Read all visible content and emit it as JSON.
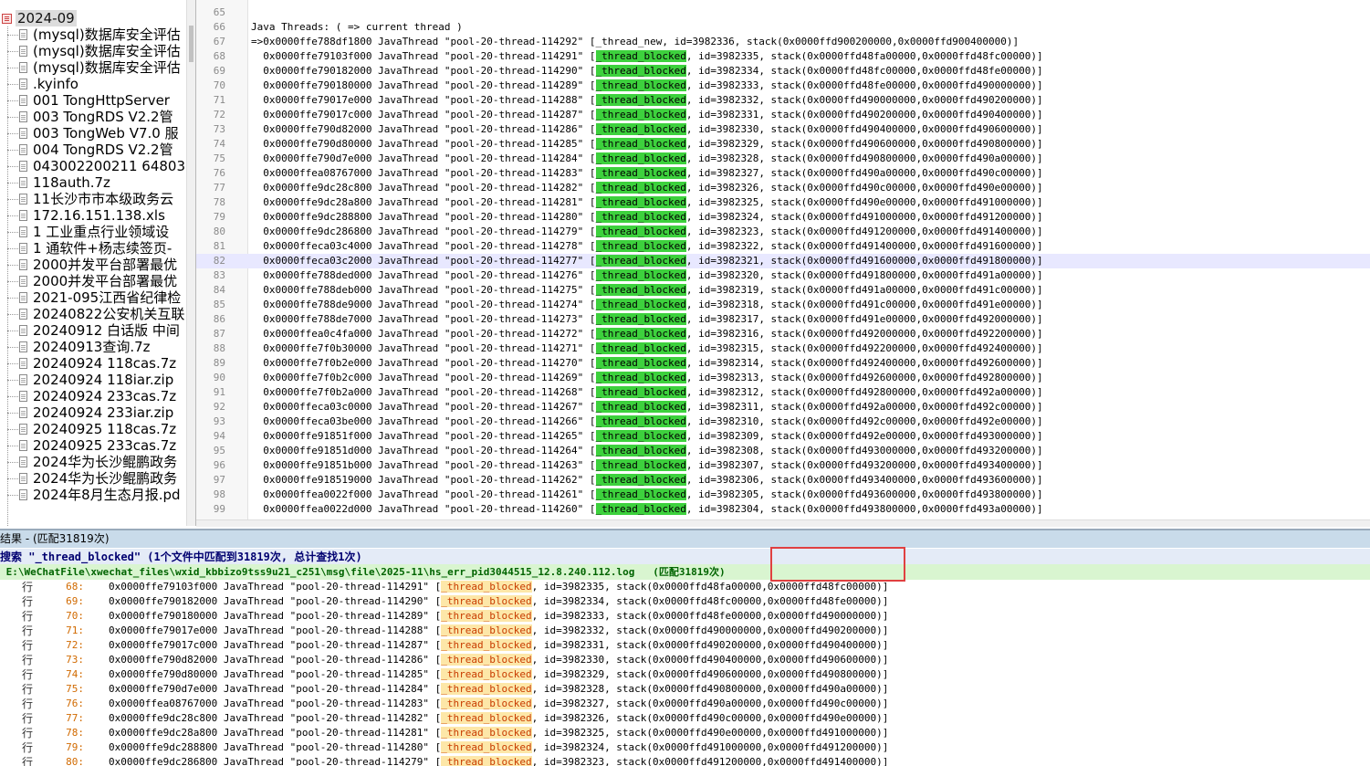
{
  "tree": {
    "root": "2024-09",
    "items": [
      "(mysql)数据库安全评估",
      "(mysql)数据库安全评估",
      "(mysql)数据库安全评估",
      ".kyinfo",
      "001 TongHttpServer",
      "003 TongRDS V2.2管",
      "003 TongWeb V7.0 服",
      "004 TongRDS V2.2管",
      "043002200211 64803",
      "118auth.7z",
      "11长沙市市本级政务云",
      "172.16.151.138.xls",
      "1 工业重点行业领域设",
      "1 通软件+杨志续签页-",
      "2000并发平台部署最优",
      "2000并发平台部署最优",
      "2021-095江西省纪律检",
      "20240822公安机关互联",
      "20240912 白话版 中间",
      "20240913查询.7z",
      "20240924 118cas.7z",
      "20240924 118iar.zip",
      "20240924 233cas.7z",
      "20240924 233iar.zip",
      "20240925 118cas.7z",
      "20240925 233cas.7z",
      "2024华为长沙鲲鹏政务",
      "2024华为长沙鲲鹏政务",
      "2024年8月生态月报.pd"
    ]
  },
  "editor": {
    "lines": [
      {
        "n": "65",
        "pre": "",
        "hl": "",
        "post": ""
      },
      {
        "n": "66",
        "pre": "Java Threads: ( => current thread )",
        "hl": "",
        "post": ""
      },
      {
        "n": "67",
        "pre": "=>0x0000ffe788df1800 JavaThread \"pool-20-thread-114292\" [_thread_new, id=3982336, stack(0x0000ffd900200000,0x0000ffd900400000)]",
        "hl": "",
        "post": ""
      },
      {
        "n": "68",
        "pre": "  0x0000ffe79103f000 JavaThread \"pool-20-thread-114291\" [",
        "hl": "_thread_blocked",
        "post": ", id=3982335, stack(0x0000ffd48fa00000,0x0000ffd48fc00000)]"
      },
      {
        "n": "69",
        "pre": "  0x0000ffe790182000 JavaThread \"pool-20-thread-114290\" [",
        "hl": "_thread_blocked",
        "post": ", id=3982334, stack(0x0000ffd48fc00000,0x0000ffd48fe00000)]"
      },
      {
        "n": "70",
        "pre": "  0x0000ffe790180000 JavaThread \"pool-20-thread-114289\" [",
        "hl": "_thread_blocked",
        "post": ", id=3982333, stack(0x0000ffd48fe00000,0x0000ffd490000000)]"
      },
      {
        "n": "71",
        "pre": "  0x0000ffe79017e000 JavaThread \"pool-20-thread-114288\" [",
        "hl": "_thread_blocked",
        "post": ", id=3982332, stack(0x0000ffd490000000,0x0000ffd490200000)]"
      },
      {
        "n": "72",
        "pre": "  0x0000ffe79017c000 JavaThread \"pool-20-thread-114287\" [",
        "hl": "_thread_blocked",
        "post": ", id=3982331, stack(0x0000ffd490200000,0x0000ffd490400000)]"
      },
      {
        "n": "73",
        "pre": "  0x0000ffe790d82000 JavaThread \"pool-20-thread-114286\" [",
        "hl": "_thread_blocked",
        "post": ", id=3982330, stack(0x0000ffd490400000,0x0000ffd490600000)]"
      },
      {
        "n": "74",
        "pre": "  0x0000ffe790d80000 JavaThread \"pool-20-thread-114285\" [",
        "hl": "_thread_blocked",
        "post": ", id=3982329, stack(0x0000ffd490600000,0x0000ffd490800000)]"
      },
      {
        "n": "75",
        "pre": "  0x0000ffe790d7e000 JavaThread \"pool-20-thread-114284\" [",
        "hl": "_thread_blocked",
        "post": ", id=3982328, stack(0x0000ffd490800000,0x0000ffd490a00000)]"
      },
      {
        "n": "76",
        "pre": "  0x0000ffea08767000 JavaThread \"pool-20-thread-114283\" [",
        "hl": "_thread_blocked",
        "post": ", id=3982327, stack(0x0000ffd490a00000,0x0000ffd490c00000)]"
      },
      {
        "n": "77",
        "pre": "  0x0000ffe9dc28c800 JavaThread \"pool-20-thread-114282\" [",
        "hl": "_thread_blocked",
        "post": ", id=3982326, stack(0x0000ffd490c00000,0x0000ffd490e00000)]"
      },
      {
        "n": "78",
        "pre": "  0x0000ffe9dc28a800 JavaThread \"pool-20-thread-114281\" [",
        "hl": "_thread_blocked",
        "post": ", id=3982325, stack(0x0000ffd490e00000,0x0000ffd491000000)]"
      },
      {
        "n": "79",
        "pre": "  0x0000ffe9dc288800 JavaThread \"pool-20-thread-114280\" [",
        "hl": "_thread_blocked",
        "post": ", id=3982324, stack(0x0000ffd491000000,0x0000ffd491200000)]"
      },
      {
        "n": "80",
        "pre": "  0x0000ffe9dc286800 JavaThread \"pool-20-thread-114279\" [",
        "hl": "_thread_blocked",
        "post": ", id=3982323, stack(0x0000ffd491200000,0x0000ffd491400000)]"
      },
      {
        "n": "81",
        "pre": "  0x0000ffeca03c4000 JavaThread \"pool-20-thread-114278\" [",
        "hl": "_thread_blocked",
        "post": ", id=3982322, stack(0x0000ffd491400000,0x0000ffd491600000)]"
      },
      {
        "n": "82",
        "pre": "  0x0000ffeca03c2000 JavaThread \"pool-20-thread-114277\" [",
        "hl": "_thread_blocked",
        "post": ", id=3982321, stack(0x0000ffd491600000,0x0000ffd491800000)]"
      },
      {
        "n": "83",
        "pre": "  0x0000ffe788ded000 JavaThread \"pool-20-thread-114276\" [",
        "hl": "_thread_blocked",
        "post": ", id=3982320, stack(0x0000ffd491800000,0x0000ffd491a00000)]"
      },
      {
        "n": "84",
        "pre": "  0x0000ffe788deb000 JavaThread \"pool-20-thread-114275\" [",
        "hl": "_thread_blocked",
        "post": ", id=3982319, stack(0x0000ffd491a00000,0x0000ffd491c00000)]"
      },
      {
        "n": "85",
        "pre": "  0x0000ffe788de9000 JavaThread \"pool-20-thread-114274\" [",
        "hl": "_thread_blocked",
        "post": ", id=3982318, stack(0x0000ffd491c00000,0x0000ffd491e00000)]"
      },
      {
        "n": "86",
        "pre": "  0x0000ffe788de7000 JavaThread \"pool-20-thread-114273\" [",
        "hl": "_thread_blocked",
        "post": ", id=3982317, stack(0x0000ffd491e00000,0x0000ffd492000000)]"
      },
      {
        "n": "87",
        "pre": "  0x0000ffea0c4fa000 JavaThread \"pool-20-thread-114272\" [",
        "hl": "_thread_blocked",
        "post": ", id=3982316, stack(0x0000ffd492000000,0x0000ffd492200000)]"
      },
      {
        "n": "88",
        "pre": "  0x0000ffe7f0b30000 JavaThread \"pool-20-thread-114271\" [",
        "hl": "_thread_blocked",
        "post": ", id=3982315, stack(0x0000ffd492200000,0x0000ffd492400000)]"
      },
      {
        "n": "89",
        "pre": "  0x0000ffe7f0b2e000 JavaThread \"pool-20-thread-114270\" [",
        "hl": "_thread_blocked",
        "post": ", id=3982314, stack(0x0000ffd492400000,0x0000ffd492600000)]"
      },
      {
        "n": "90",
        "pre": "  0x0000ffe7f0b2c000 JavaThread \"pool-20-thread-114269\" [",
        "hl": "_thread_blocked",
        "post": ", id=3982313, stack(0x0000ffd492600000,0x0000ffd492800000)]"
      },
      {
        "n": "91",
        "pre": "  0x0000ffe7f0b2a000 JavaThread \"pool-20-thread-114268\" [",
        "hl": "_thread_blocked",
        "post": ", id=3982312, stack(0x0000ffd492800000,0x0000ffd492a00000)]"
      },
      {
        "n": "92",
        "pre": "  0x0000ffeca03c0000 JavaThread \"pool-20-thread-114267\" [",
        "hl": "_thread_blocked",
        "post": ", id=3982311, stack(0x0000ffd492a00000,0x0000ffd492c00000)]"
      },
      {
        "n": "93",
        "pre": "  0x0000ffeca03be000 JavaThread \"pool-20-thread-114266\" [",
        "hl": "_thread_blocked",
        "post": ", id=3982310, stack(0x0000ffd492c00000,0x0000ffd492e00000)]"
      },
      {
        "n": "94",
        "pre": "  0x0000ffe91851f000 JavaThread \"pool-20-thread-114265\" [",
        "hl": "_thread_blocked",
        "post": ", id=3982309, stack(0x0000ffd492e00000,0x0000ffd493000000)]"
      },
      {
        "n": "95",
        "pre": "  0x0000ffe91851d000 JavaThread \"pool-20-thread-114264\" [",
        "hl": "_thread_blocked",
        "post": ", id=3982308, stack(0x0000ffd493000000,0x0000ffd493200000)]"
      },
      {
        "n": "96",
        "pre": "  0x0000ffe91851b000 JavaThread \"pool-20-thread-114263\" [",
        "hl": "_thread_blocked",
        "post": ", id=3982307, stack(0x0000ffd493200000,0x0000ffd493400000)]"
      },
      {
        "n": "97",
        "pre": "  0x0000ffe918519000 JavaThread \"pool-20-thread-114262\" [",
        "hl": "_thread_blocked",
        "post": ", id=3982306, stack(0x0000ffd493400000,0x0000ffd493600000)]"
      },
      {
        "n": "98",
        "pre": "  0x0000ffea0022f000 JavaThread \"pool-20-thread-114261\" [",
        "hl": "_thread_blocked",
        "post": ", id=3982305, stack(0x0000ffd493600000,0x0000ffd493800000)]"
      },
      {
        "n": "99",
        "pre": "  0x0000ffea0022d000 JavaThread \"pool-20-thread-114260\" [",
        "hl": "_thread_blocked",
        "post": ", id=3982304, stack(0x0000ffd493800000,0x0000ffd493a00000)]"
      }
    ],
    "current_line": "82"
  },
  "results": {
    "title": "结果 - (匹配31819次)",
    "search_summary": "搜索 \"_thread_blocked\" (1个文件中匹配到31819次, 总计查找1次)",
    "file_path": " E:\\WeChatFile\\xwechat_files\\wxid_kbbizo9tss9u21_c251\\msg\\file\\2025-11\\hs_err_pid3044515_12.8.240.112.log",
    "file_match_count": " (匹配31819次)",
    "line_prefix": "行",
    "rows": [
      {
        "n": "68:",
        "pre": "0x0000ffe79103f000 JavaThread \"pool-20-thread-114291\" [",
        "hl": "_thread_blocked",
        "post": ", id=3982335, stack(0x0000ffd48fa00000,0x0000ffd48fc00000)]"
      },
      {
        "n": "69:",
        "pre": "0x0000ffe790182000 JavaThread \"pool-20-thread-114290\" [",
        "hl": "_thread_blocked",
        "post": ", id=3982334, stack(0x0000ffd48fc00000,0x0000ffd48fe00000)]"
      },
      {
        "n": "70:",
        "pre": "0x0000ffe790180000 JavaThread \"pool-20-thread-114289\" [",
        "hl": "_thread_blocked",
        "post": ", id=3982333, stack(0x0000ffd48fe00000,0x0000ffd490000000)]"
      },
      {
        "n": "71:",
        "pre": "0x0000ffe79017e000 JavaThread \"pool-20-thread-114288\" [",
        "hl": "_thread_blocked",
        "post": ", id=3982332, stack(0x0000ffd490000000,0x0000ffd490200000)]"
      },
      {
        "n": "72:",
        "pre": "0x0000ffe79017c000 JavaThread \"pool-20-thread-114287\" [",
        "hl": "_thread_blocked",
        "post": ", id=3982331, stack(0x0000ffd490200000,0x0000ffd490400000)]"
      },
      {
        "n": "73:",
        "pre": "0x0000ffe790d82000 JavaThread \"pool-20-thread-114286\" [",
        "hl": "_thread_blocked",
        "post": ", id=3982330, stack(0x0000ffd490400000,0x0000ffd490600000)]"
      },
      {
        "n": "74:",
        "pre": "0x0000ffe790d80000 JavaThread \"pool-20-thread-114285\" [",
        "hl": "_thread_blocked",
        "post": ", id=3982329, stack(0x0000ffd490600000,0x0000ffd490800000)]"
      },
      {
        "n": "75:",
        "pre": "0x0000ffe790d7e000 JavaThread \"pool-20-thread-114284\" [",
        "hl": "_thread_blocked",
        "post": ", id=3982328, stack(0x0000ffd490800000,0x0000ffd490a00000)]"
      },
      {
        "n": "76:",
        "pre": "0x0000ffea08767000 JavaThread \"pool-20-thread-114283\" [",
        "hl": "_thread_blocked",
        "post": ", id=3982327, stack(0x0000ffd490a00000,0x0000ffd490c00000)]"
      },
      {
        "n": "77:",
        "pre": "0x0000ffe9dc28c800 JavaThread \"pool-20-thread-114282\" [",
        "hl": "_thread_blocked",
        "post": ", id=3982326, stack(0x0000ffd490c00000,0x0000ffd490e00000)]"
      },
      {
        "n": "78:",
        "pre": "0x0000ffe9dc28a800 JavaThread \"pool-20-thread-114281\" [",
        "hl": "_thread_blocked",
        "post": ", id=3982325, stack(0x0000ffd490e00000,0x0000ffd491000000)]"
      },
      {
        "n": "79:",
        "pre": "0x0000ffe9dc288800 JavaThread \"pool-20-thread-114280\" [",
        "hl": "_thread_blocked",
        "post": ", id=3982324, stack(0x0000ffd491000000,0x0000ffd491200000)]"
      },
      {
        "n": "80:",
        "pre": "0x0000ffe9dc286800 JavaThread \"pool-20-thread-114279\" [",
        "hl": "_thread_blocked",
        "post": ", id=3982323, stack(0x0000ffd491200000,0x0000ffd491400000)]"
      }
    ]
  },
  "colors": {
    "highlight_green": "#3dd13d",
    "highlight_yellow": "#fde7a8",
    "match_box": "#e04040"
  }
}
